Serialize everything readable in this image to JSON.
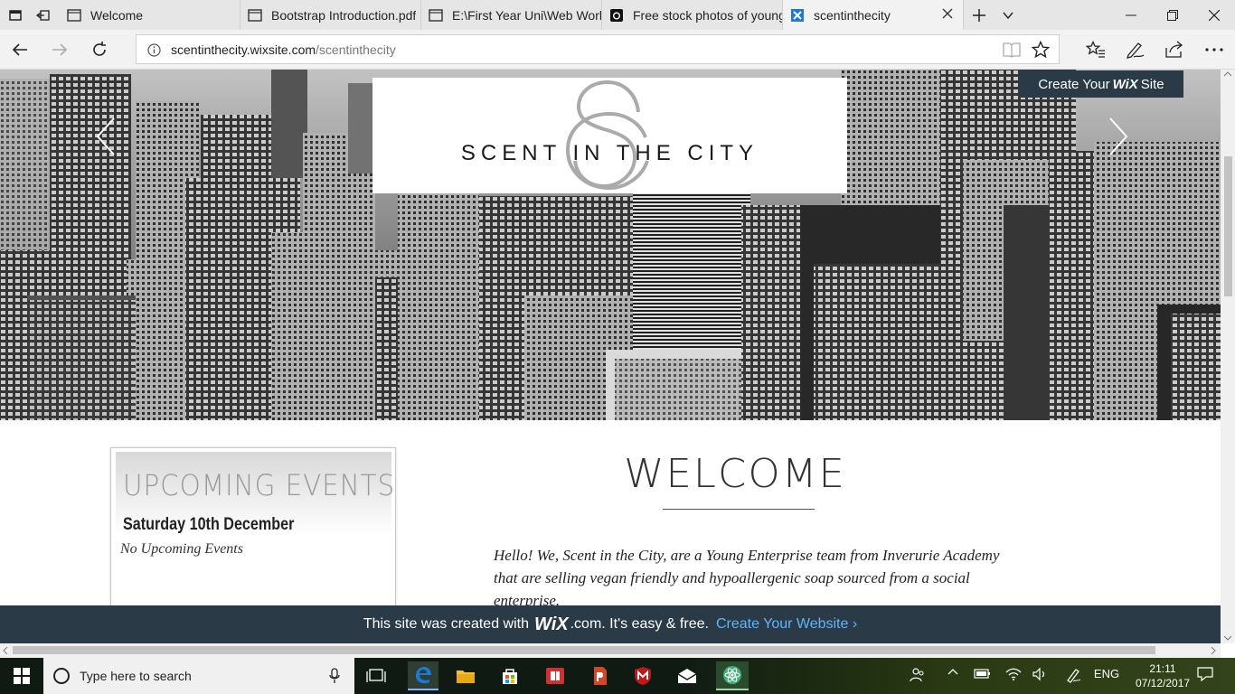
{
  "tabs": [
    {
      "label": "Welcome",
      "active": false,
      "icon": "page-icon"
    },
    {
      "label": "Bootstrap Introduction.pdf",
      "active": false,
      "icon": "page-icon"
    },
    {
      "label": "E:\\First Year Uni\\Web Work\\",
      "active": false,
      "icon": "page-icon"
    },
    {
      "label": "Free stock photos of young",
      "active": false,
      "icon": "camera-icon"
    },
    {
      "label": "scentinthecity",
      "active": true,
      "icon": "wix-icon"
    }
  ],
  "address": {
    "host": "scentinthecity.wixsite.com",
    "path": "/scentinthecity"
  },
  "hero": {
    "logo_text": "SCENT IN THE CITY",
    "wix_button": {
      "prefix": "Create Your",
      "brand": "WiX",
      "suffix": "Site"
    }
  },
  "events": {
    "title": "UPCOMING EVENTS",
    "date": "Saturday 10th December",
    "empty": "No Upcoming Events"
  },
  "welcome": {
    "title": "WELCOME",
    "text": "Hello! We, Scent in the City, are a Young Enterprise team from Inverurie Academy that are selling vegan friendly and hypoallergenic soap sourced from a social enterprise."
  },
  "banner": {
    "prefix": "This site was created with",
    "brand": "WiX",
    "suffix": ".com. It's easy & free.",
    "cta": "Create Your Website ›"
  },
  "taskbar": {
    "search_placeholder": "Type here to search",
    "language": "ENG",
    "time": "21:11",
    "date": "07/12/2017"
  },
  "colors": {
    "wix_dark": "#2b3a47",
    "wix_link": "#5fb4ff",
    "edge_blue": "#1e78d6"
  }
}
